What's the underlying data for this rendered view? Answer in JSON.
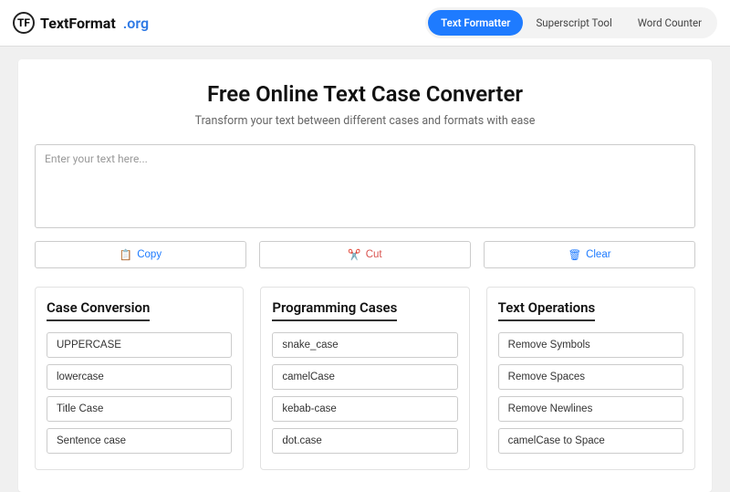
{
  "header": {
    "logo_mark": "TF",
    "logo_text": "TextFormat",
    "logo_suffix": ".org",
    "nav": [
      {
        "label": "Text Formatter",
        "active": true
      },
      {
        "label": "Superscript Tool",
        "active": false
      },
      {
        "label": "Word Counter",
        "active": false
      }
    ]
  },
  "main": {
    "title": "Free Online Text Case Converter",
    "subtitle": "Transform your text between different cases and formats with ease",
    "input_placeholder": "Enter your text here...",
    "input_value": "",
    "actions": {
      "copy": {
        "label": "Copy",
        "icon": "📋"
      },
      "cut": {
        "label": "Cut",
        "icon": "✂️"
      },
      "clear": {
        "label": "Clear",
        "icon": "🗑"
      }
    },
    "columns": [
      {
        "title": "Case Conversion",
        "options": [
          "UPPERCASE",
          "lowercase",
          "Title Case",
          "Sentence case"
        ]
      },
      {
        "title": "Programming Cases",
        "options": [
          "snake_case",
          "camelCase",
          "kebab-case",
          "dot.case"
        ]
      },
      {
        "title": "Text Operations",
        "options": [
          "Remove Symbols",
          "Remove Spaces",
          "Remove Newlines",
          "camelCase to Space"
        ]
      }
    ]
  }
}
